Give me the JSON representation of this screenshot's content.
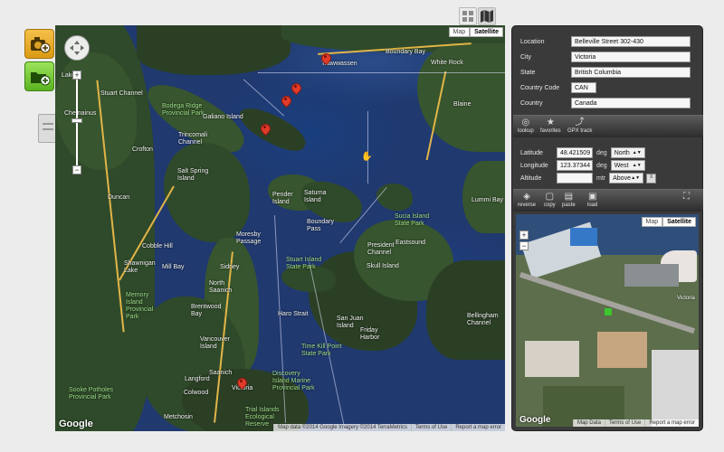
{
  "left_tools": {
    "add_photo_icon": "camera-plus-icon",
    "add_folder_icon": "folder-plus-icon",
    "document_icon": "document-icon"
  },
  "top_icons": [
    "grid-icon",
    "map-icon"
  ],
  "map": {
    "type_buttons": [
      "Map",
      "Satellite"
    ],
    "selected_type": "Satellite",
    "logo": "Google",
    "attribution": [
      "Map data ©2014 Google Imagery ©2014 TerraMetrics",
      "Terms of Use",
      "Report a map error"
    ],
    "labels": {
      "tsawwassen": "Tsawwassen",
      "white_rock": "White Rock",
      "boundary_bay": "Boundary Bay",
      "lake": "Lake",
      "stuart_channel": "Stuart Channel",
      "chemainus": "Chemainus",
      "bodega": "Bodega Ridge Provincial Park",
      "galiano": "Galiano Island",
      "trincomali": "Trincomali Channel",
      "crofton": "Crofton",
      "salt_spring": "Salt Spring Island",
      "duncan": "Duncan",
      "pender": "Pender Island",
      "saturna": "Saturna Island",
      "sucia": "Sucia Island State Park",
      "boundary_pass": "Boundary Pass",
      "eastsound": "Eastsound",
      "president": "President Channel",
      "moresby": "Moresby Passage",
      "cobble_hill": "Cobble Hill",
      "shawnigan": "Shawnigan Lake",
      "mill_bay": "Mill Bay",
      "stuart_island": "Stuart Island State Park",
      "skull": "Skull Island",
      "sidney": "Sidney",
      "memory": "Memory Island Provincial Park",
      "north_saanich": "North Saanich",
      "brentwood": "Brentwood Bay",
      "friday": "Friday Harbor",
      "haro": "Haro Strait",
      "san_juan": "San Juan Island",
      "vancouver": "Vancouver Island",
      "time_kill": "Time Kill Point State Park",
      "saanich": "Saanich",
      "langford": "Langford",
      "discovery": "Discovery Island Marine Provincial Park",
      "victoria": "Victoria",
      "colwood": "Colwood",
      "sooke": "Sooke Potholes Provincial Park",
      "metchosin": "Metchosin",
      "trial": "Trial Islands Ecological Reserve",
      "blaine": "Blaine",
      "bellingham": "Bellingham Channel",
      "lummi": "Lummi Bay"
    }
  },
  "location": {
    "location_label": "Location",
    "location_value": "Belleville Street 302-430",
    "city_label": "City",
    "city_value": "Victoria",
    "state_label": "State",
    "state_value": "British Columbia",
    "country_code_label": "Country Code",
    "country_code_value": "CAN",
    "country_label": "Country",
    "country_value": "Canada"
  },
  "toolbar1": [
    {
      "icon": "lookup-icon",
      "label": "lookup"
    },
    {
      "icon": "star-icon",
      "label": "favorites"
    },
    {
      "icon": "gpx-track-icon",
      "label": "GPX track"
    }
  ],
  "coords": {
    "latitude_label": "Latitude",
    "latitude_value": "48.421509",
    "latitude_unit": "deg",
    "latitude_dir": "North",
    "longitude_label": "Longitude",
    "longitude_value": "123.37344",
    "longitude_unit": "deg",
    "longitude_dir": "West",
    "altitude_label": "Altitude",
    "altitude_value": "",
    "altitude_unit": "mtr",
    "altitude_ref": "Above"
  },
  "toolbar2": [
    {
      "icon": "reverse-icon",
      "label": "reverse"
    },
    {
      "icon": "copy-icon",
      "label": "copy"
    },
    {
      "icon": "paste-icon",
      "label": "paste"
    },
    {
      "icon": "load-icon",
      "label": "load"
    }
  ],
  "minimap": {
    "type_buttons": [
      "Map",
      "Satellite"
    ],
    "selected_type": "Satellite",
    "logo": "Google",
    "attribution": [
      "Map Data",
      "Terms of Use",
      "Report a map error"
    ],
    "label_victoria": "Victoria"
  }
}
